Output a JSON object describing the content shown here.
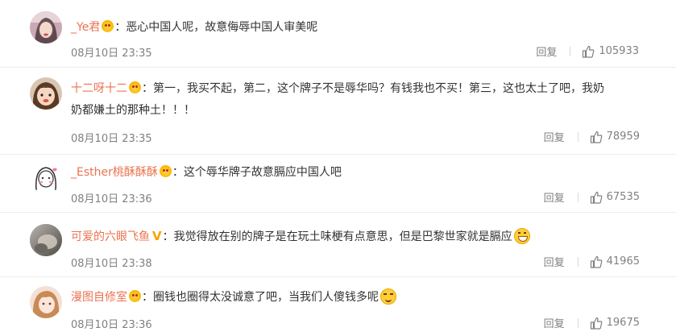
{
  "comments": [
    {
      "username": "_Ye君",
      "badge": "crown-emoji-badge",
      "text": "恶心中国人呢，故意侮辱中国人审美呢",
      "time": "08月10日 23:35",
      "reply_label": "回复",
      "likes": "105933"
    },
    {
      "username": "十二呀十二",
      "badge": "crown-emoji-badge",
      "text_line1": "第一，我买不起，第二，这个牌子不是辱华吗？有钱我也不买！第三，这也太土了吧，我奶",
      "text_line2": "奶都嫌土的那种土！！！",
      "time": "08月10日 23:35",
      "reply_label": "回复",
      "likes": "78959"
    },
    {
      "username": "_Esther桃酥酥酥",
      "badge": "crown-emoji-badge",
      "text": "这个辱华牌子故意膈应中国人吧",
      "time": "08月10日 23:36",
      "reply_label": "回复",
      "likes": "67535"
    },
    {
      "username": "可爱的六眼飞鱼",
      "badge": "v-badge",
      "badge_text": "V",
      "text": "我觉得放在别的牌子是在玩土味梗有点意思，但是巴黎世家就是膈应",
      "time": "08月10日 23:38",
      "reply_label": "回复",
      "likes": "41965"
    },
    {
      "username": "漫图自修室",
      "badge": "crown-emoji-badge",
      "text": "圈钱也圈得太没诚意了吧，当我们人傻钱多呢",
      "time": "08月10日 23:36",
      "reply_label": "回复",
      "likes": "19675"
    }
  ],
  "colors": {
    "username": "#eb7350",
    "text": "#333333",
    "meta": "#808080"
  },
  "separator": "："
}
